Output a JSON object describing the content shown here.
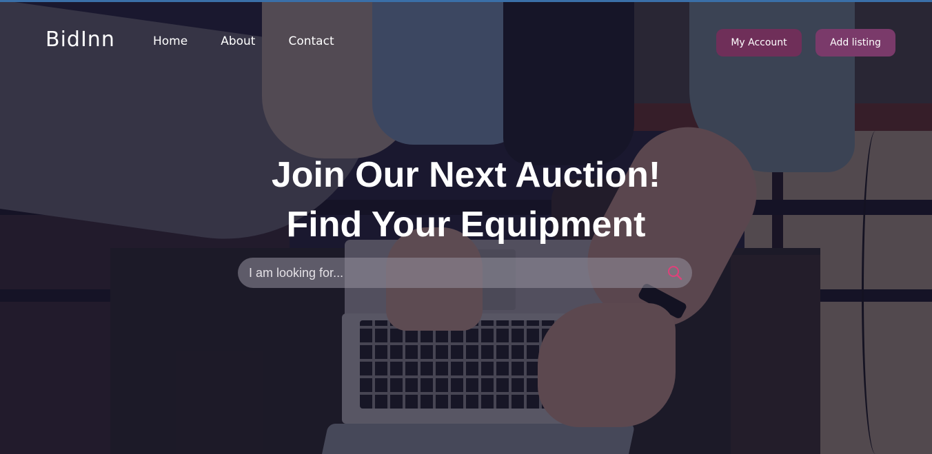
{
  "nav": {
    "logo": "BidInn",
    "links": [
      "Home",
      "About",
      "Contact"
    ],
    "account_label": "My Account",
    "add_listing_label": "Add listing"
  },
  "hero": {
    "headline_line1": "Join Our Next Auction!",
    "headline_line2": "Find Your Equipment"
  },
  "search": {
    "placeholder": "I am looking for...",
    "value": "",
    "icon": "search-icon"
  },
  "colors": {
    "account_button": "#6f2f59",
    "listing_button": "#7a3a6a",
    "search_icon": "#e0407a",
    "overlay": "#14122a"
  }
}
